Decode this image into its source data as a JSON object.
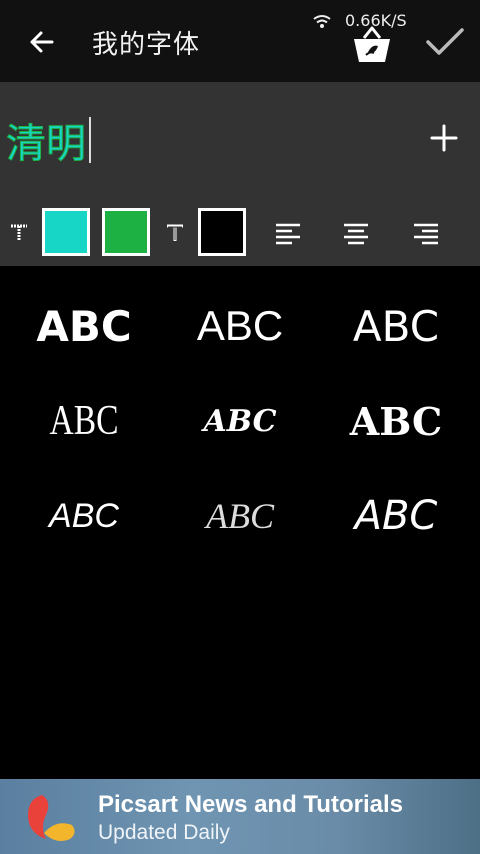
{
  "header": {
    "title": "我的字体",
    "network_speed": "0.66K/S"
  },
  "editor": {
    "text": "清明",
    "colors": {
      "fill": "#17D6C6",
      "stroke": "#1DB144",
      "shadow": "#000000"
    }
  },
  "fonts": [
    {
      "label": "ABC"
    },
    {
      "label": "ABC"
    },
    {
      "label": "ABC"
    },
    {
      "label": "ABC"
    },
    {
      "label": "ABC"
    },
    {
      "label": "ABC"
    },
    {
      "label": "ABC"
    },
    {
      "label": "ABC"
    },
    {
      "label": "ABC"
    }
  ],
  "banner": {
    "title": "Picsart News and Tutorials",
    "subtitle": "Updated Daily"
  },
  "icons": [
    "back-arrow-icon",
    "wifi-icon",
    "shopping-bag-icon",
    "checkmark-icon",
    "add-icon",
    "text-style-icon",
    "align-left-icon",
    "align-center-icon",
    "align-right-icon",
    "picsart-logo-icon"
  ]
}
